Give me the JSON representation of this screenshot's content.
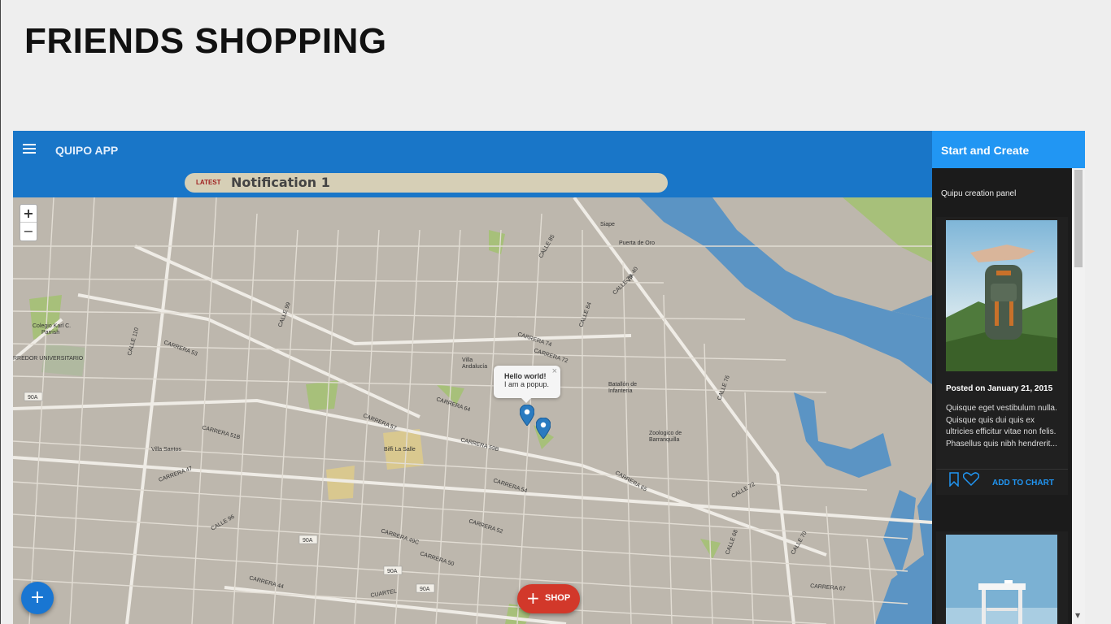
{
  "page": {
    "title": "FRIENDS SHOPPING"
  },
  "appbar": {
    "title": "QUIPO APP",
    "menu_icon": "menu-icon"
  },
  "notification": {
    "badge": "LATEST",
    "text": "Notification 1"
  },
  "map": {
    "zoom_in": "+",
    "zoom_out": "−",
    "popup": {
      "line1": "Hello world!",
      "line2": "I am a popup.",
      "close": "×"
    },
    "labels": [
      "Siape",
      "Puerta de Oro",
      "VIA 40",
      "Colegio Karl C. Parrish",
      "RREDOR UNIVERSITARIO",
      "90A",
      "Villa Andalucía",
      "Batallón de Infantería",
      "Zoologico de Barranquilla",
      "Villa Santos",
      "Biffi La Salle",
      "CARRERA 53",
      "CARRERA 51B",
      "CARRERA 47",
      "CARRERA 49C",
      "CARRERA 50",
      "CARRERA 52",
      "CARRERA 54",
      "CARRERA 57",
      "CARRERA 59B",
      "CARRERA 64",
      "CARRERA 74",
      "CARRERA 72",
      "CALLE 110",
      "CALLE 96",
      "CALLE 99",
      "CALLE 85",
      "CALLE 84",
      "CALLE 79",
      "CALLE 76",
      "CALLE 72",
      "CALLE 70",
      "CALLE 68",
      "CARRERA 65",
      "CARRERA 67",
      "CARRERA 44",
      "CUARTEL"
    ]
  },
  "fab": {
    "add_icon": "+",
    "shop_icon": "+",
    "shop_label": "SHOP"
  },
  "sidebar": {
    "title": "Start and Create",
    "subtitle": "Quipu creation panel",
    "cards": [
      {
        "date": "Posted on January 21, 2015",
        "description": "Quisque eget vestibulum nulla. Quisque quis dui quis ex ultricies efficitur vitae non felis. Phasellus quis nibh hendrerit...",
        "action": "ADD TO CHART",
        "bookmark_icon": "bookmark-icon",
        "heart_icon": "heart-icon"
      }
    ],
    "scroll_down": "▼"
  },
  "colors": {
    "appbar": "#1976c8",
    "sidebar_header": "#2196f3",
    "sidebar_bg": "#1b1b1b",
    "fab_add": "#1976d2",
    "fab_shop": "#d2382a",
    "map_land": "#bdb7ad",
    "map_water": "#5b94c4",
    "map_park": "#a7c07a",
    "map_road": "#efece6"
  }
}
